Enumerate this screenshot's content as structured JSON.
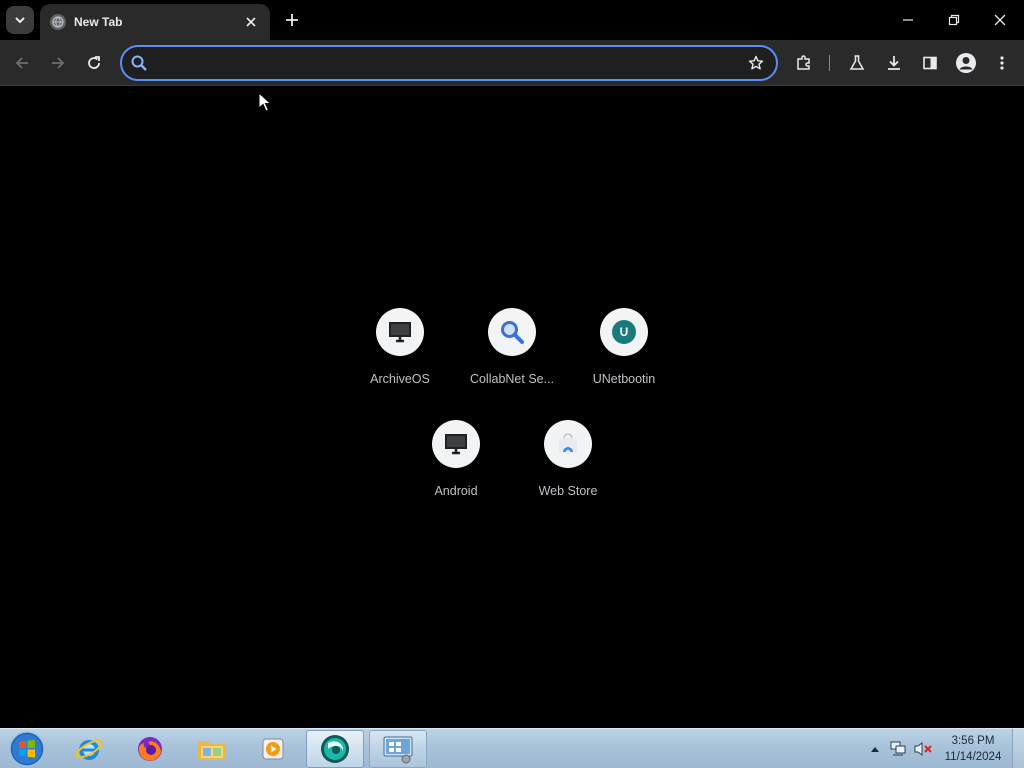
{
  "tabstrip": {
    "tab_title": "New Tab"
  },
  "toolbar": {
    "omnibox_value": "",
    "omnibox_placeholder": ""
  },
  "shortcuts": [
    {
      "label": "ArchiveOS",
      "icon": "monitor-icon"
    },
    {
      "label": "CollabNet Se...",
      "icon": "magnifier-icon"
    },
    {
      "label": "UNetbootin",
      "icon": "letter-badge-icon",
      "badge": "U",
      "badge_color": "#1a7b7b"
    },
    {
      "label": "Android",
      "icon": "monitor-icon"
    },
    {
      "label": "Web Store",
      "icon": "web-store-icon"
    }
  ],
  "taskbar": {
    "apps": [
      "start-orb",
      "internet-explorer",
      "firefox",
      "file-explorer",
      "media-player",
      "browser",
      "control-panel"
    ],
    "clock_time": "3:56 PM",
    "clock_date": "11/14/2024"
  },
  "colors": {
    "accent": "#5b8ef5",
    "toolbar_bg": "#2a2a2a",
    "page_bg": "#000000",
    "taskbar": "#a8c2da"
  }
}
